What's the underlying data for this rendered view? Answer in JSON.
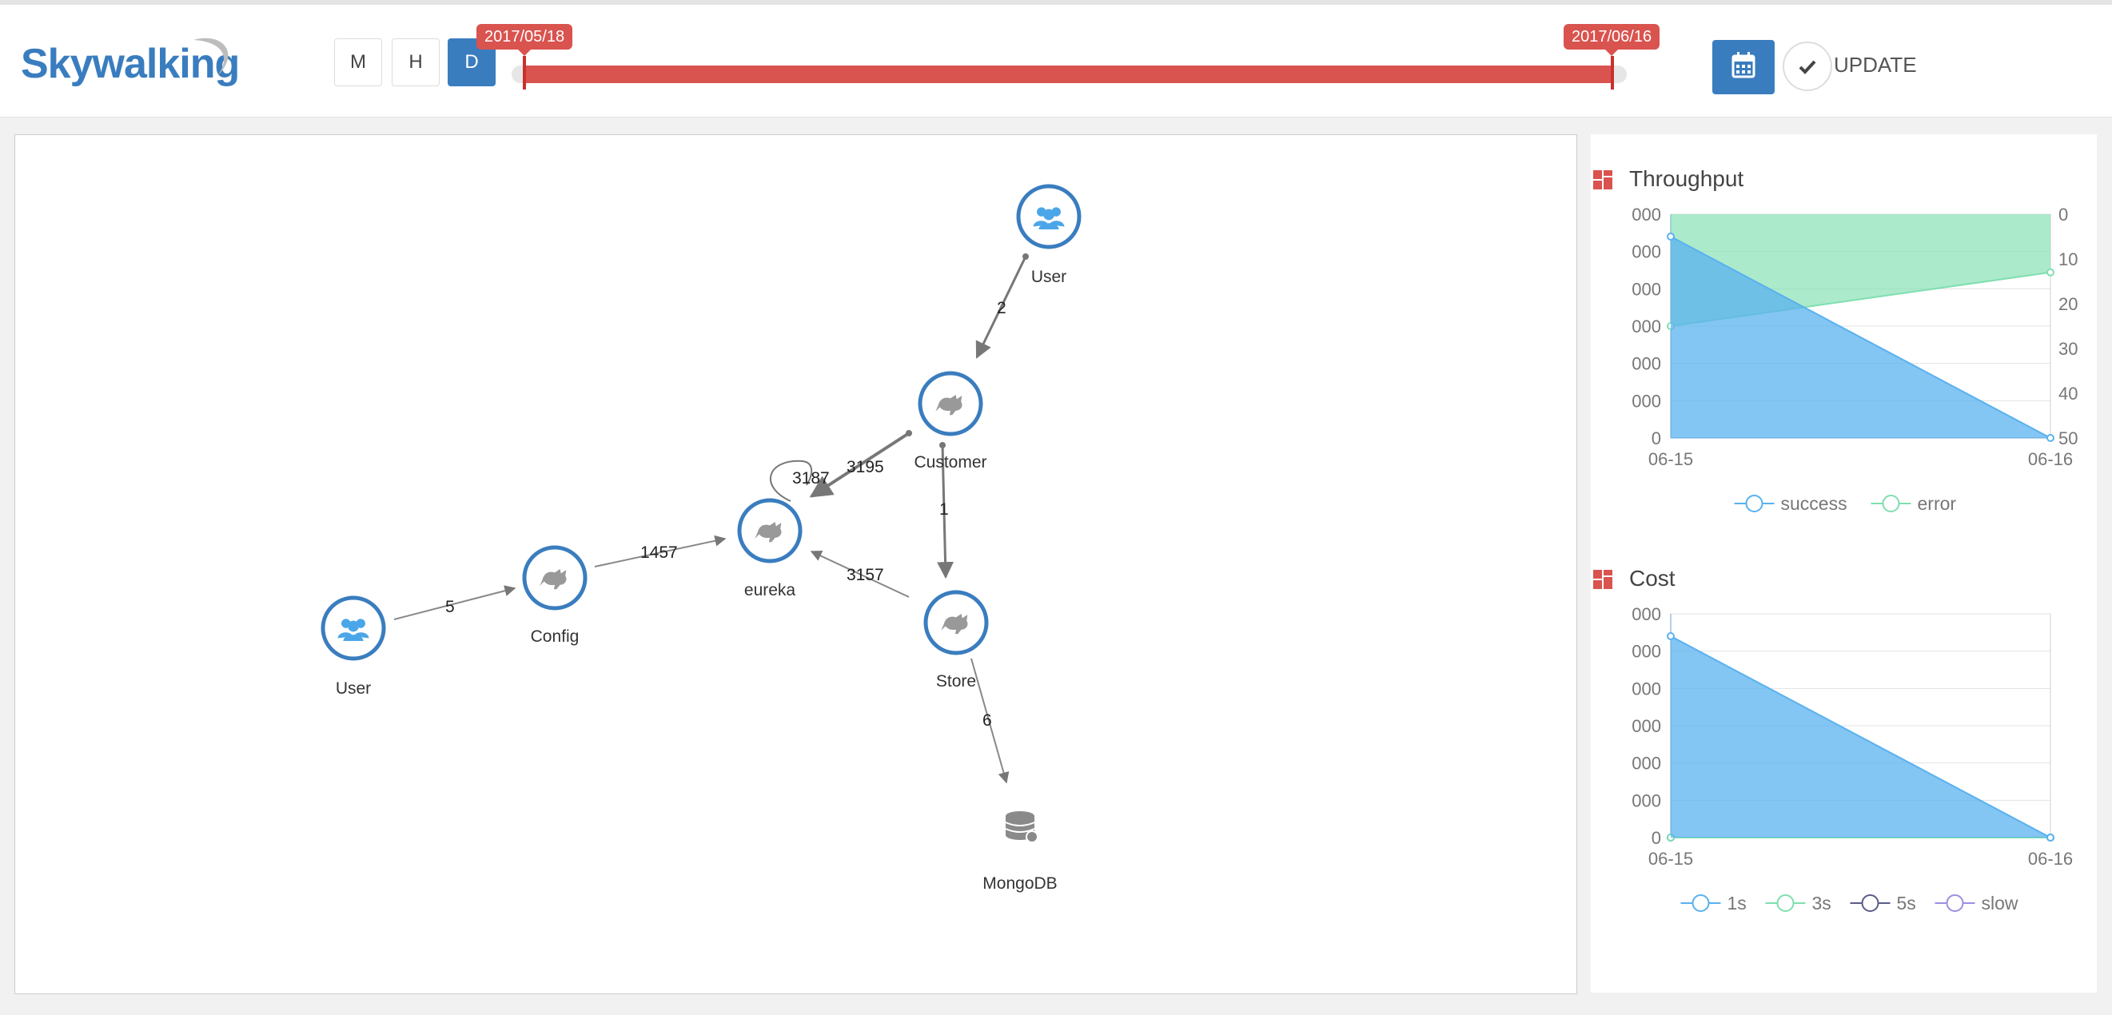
{
  "header": {
    "logo_text": "Skywalking",
    "time_units": [
      "M",
      "H",
      "D"
    ],
    "active_unit": "D",
    "range_start": "2017/05/18",
    "range_end": "2017/06/16",
    "update_label": "UPDATE",
    "accent_color": "#3a7dbf",
    "slider_color": "#d9534f"
  },
  "topology": {
    "nodes": [
      {
        "id": "user1",
        "label": "User",
        "icon": "users-icon"
      },
      {
        "id": "customer",
        "label": "Customer",
        "icon": "tomcat-icon"
      },
      {
        "id": "eureka",
        "label": "eureka",
        "icon": "tomcat-icon"
      },
      {
        "id": "config",
        "label": "Config",
        "icon": "tomcat-icon"
      },
      {
        "id": "user2",
        "label": "User",
        "icon": "users-icon"
      },
      {
        "id": "store",
        "label": "Store",
        "icon": "tomcat-icon"
      },
      {
        "id": "mongodb",
        "label": "MongoDB",
        "icon": "database-icon"
      }
    ],
    "edges": [
      {
        "from": "user1",
        "to": "customer",
        "label": "2"
      },
      {
        "from": "customer",
        "to": "eureka",
        "label": "3195"
      },
      {
        "from": "eureka",
        "to": "eureka",
        "label": "3187"
      },
      {
        "from": "customer",
        "to": "store",
        "label": "1"
      },
      {
        "from": "store",
        "to": "eureka",
        "label": "3157"
      },
      {
        "from": "config",
        "to": "eureka",
        "label": "1457"
      },
      {
        "from": "user2",
        "to": "config",
        "label": "5"
      },
      {
        "from": "store",
        "to": "mongodb",
        "label": "6"
      }
    ]
  },
  "chart_data": [
    {
      "type": "area",
      "title": "Throughput",
      "x": [
        "06-15",
        "06-16"
      ],
      "y_left_ticks": [
        "000",
        "000",
        "000",
        "000",
        "000",
        "000",
        "0"
      ],
      "y_right_ticks": [
        "0",
        "10",
        "20",
        "30",
        "40",
        "50"
      ],
      "y_right_lim": [
        0,
        50
      ],
      "series": [
        {
          "name": "success",
          "color": "#5ab1ef",
          "axis": "left",
          "values": [
            0.9,
            0.0
          ]
        },
        {
          "name": "error",
          "color": "#7fdfb0",
          "axis": "right",
          "values": [
            25,
            13
          ]
        }
      ],
      "legend": "bottom",
      "grid": true
    },
    {
      "type": "area",
      "title": "Cost",
      "x": [
        "06-15",
        "06-16"
      ],
      "y_left_ticks": [
        "000",
        "000",
        "000",
        "000",
        "000",
        "000",
        "0"
      ],
      "series": [
        {
          "name": "1s",
          "color": "#5ab1ef",
          "values": [
            0.9,
            0.0
          ]
        },
        {
          "name": "3s",
          "color": "#7fdfb0",
          "values": [
            0,
            0
          ]
        },
        {
          "name": "5s",
          "color": "#5a5c88",
          "values": [
            0,
            0
          ]
        },
        {
          "name": "slow",
          "color": "#9a8fe0",
          "values": [
            0,
            0
          ]
        }
      ],
      "legend": "bottom",
      "grid": true
    }
  ]
}
